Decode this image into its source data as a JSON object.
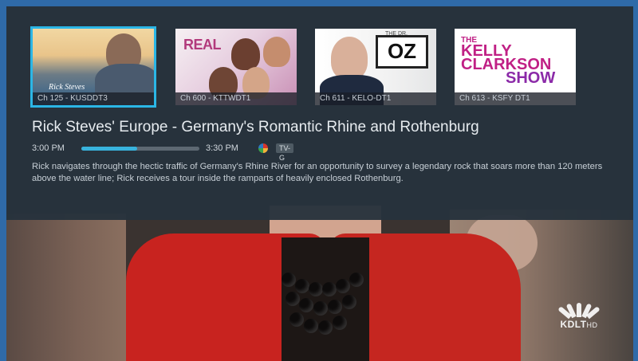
{
  "channels": [
    {
      "label": "Ch 125 - KUSDDT3",
      "selected": true
    },
    {
      "label": "Ch 600 - KTTWDT1",
      "selected": false
    },
    {
      "label": "Ch 611 - KELO-DT1",
      "selected": false
    },
    {
      "label": "Ch 613 - KSFY DT1",
      "selected": false
    }
  ],
  "program": {
    "title": "Rick Steves' Europe - Germany's Romantic Rhine and Rothenburg",
    "start_time": "3:00 PM",
    "end_time": "3:30 PM",
    "progress": 0.47,
    "rating": "TV-G",
    "description": "Rick navigates through the hectic traffic of Germany's Rhine River for an opportunity to survey a legendary rock that soars more than 120 meters above the water line; Rick receives a tour inside the ramparts of heavily enclosed Rothenburg."
  },
  "tiles": {
    "real_logo": "REAL",
    "oz_small": "THE DR.",
    "oz_logo": "OZ",
    "kelly_the": "THE",
    "kelly_line1": "KELLY",
    "kelly_line2": "CLARKSON",
    "kelly_line3": "SHOW",
    "rick_signature": "Rick Steves"
  },
  "station_bug": {
    "name": "KDLT",
    "suffix": "HD"
  },
  "colors": {
    "accent": "#2bb6e6",
    "overlay": "#26323c"
  }
}
